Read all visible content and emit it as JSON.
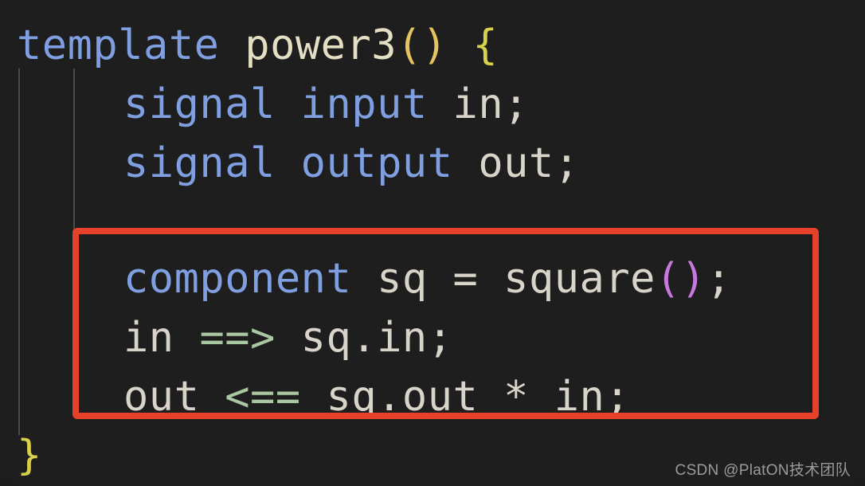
{
  "editor": {
    "background_color": "#1e1e1e",
    "language": "circom",
    "indent_guides": 2
  },
  "colors": {
    "background": "#1e1e1e",
    "keyword": "#7f9fe0",
    "function_name": "#e4dfc4",
    "identifier": "#d8d4ca",
    "paren_yellow": "#e5c460",
    "brace_yellow": "#d8d14a",
    "paren_magenta": "#c678dd",
    "operator_green": "#a9c7a3",
    "annotation_red": "#e8412a",
    "indent_guide": "#5a5a5a",
    "watermark": "#9b9b9b"
  },
  "code": {
    "line_1": {
      "keyword": "template",
      "space_1": " ",
      "function_name": "power3",
      "parens": "()",
      "space_2": " ",
      "open_brace": "{"
    },
    "line_2": {
      "keyword": "signal",
      "space_1": " ",
      "modifier": "input",
      "space_2": " ",
      "identifier": "in",
      "semicolon": ";"
    },
    "line_3": {
      "keyword": "signal",
      "space_1": " ",
      "modifier": "output",
      "space_2": " ",
      "identifier": "out",
      "semicolon": ";"
    },
    "line_4": {
      "keyword": "component",
      "space_1": " ",
      "identifier": "sq",
      "space_2": " ",
      "assign": "=",
      "space_3": " ",
      "call_name": "square",
      "parens": "()",
      "semicolon": ";"
    },
    "line_5": {
      "identifier_left": "in",
      "space_1": " ",
      "operator": "==>",
      "space_2": " ",
      "identifier_right": "sq.in",
      "semicolon": ";"
    },
    "line_6": {
      "identifier_left": "out",
      "space_1": " ",
      "operator": "<==",
      "space_2": " ",
      "operand_1": "sq.out",
      "space_3": " ",
      "star": "*",
      "space_4": " ",
      "operand_2": "in",
      "semicolon": ";"
    },
    "line_7": {
      "close_brace": "}"
    }
  },
  "annotation": {
    "shape": "rectangle",
    "color": "#e8412a",
    "border_width_px": 8,
    "covers_lines": "component sq = square(); / in ==> sq.in; / out <== sq.out * in;"
  },
  "watermark": {
    "text": "CSDN @PlatON技术团队"
  }
}
